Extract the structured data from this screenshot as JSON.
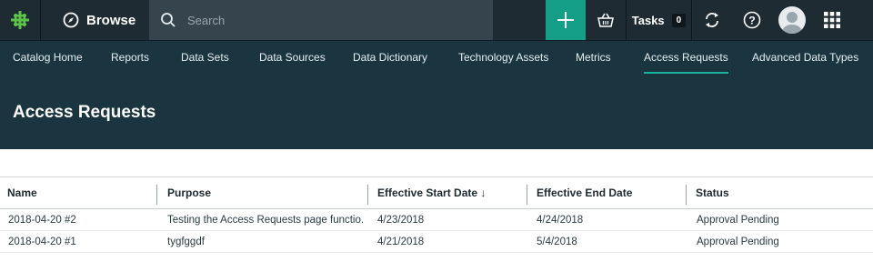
{
  "topbar": {
    "browse_label": "Browse",
    "search_placeholder": "Search",
    "tasks_label": "Tasks",
    "tasks_count": "0",
    "accent_color": "#149e88"
  },
  "nav": {
    "items": [
      {
        "label": "Catalog Home"
      },
      {
        "label": "Reports"
      },
      {
        "label": "Data Sets"
      },
      {
        "label": "Data Sources"
      },
      {
        "label": "Data Dictionary"
      },
      {
        "label": "Technology Assets"
      },
      {
        "label": "Metrics"
      },
      {
        "label": "Access Requests"
      },
      {
        "label": "Advanced Data Types"
      }
    ],
    "active": "Access Requests"
  },
  "page": {
    "title": "Access Requests"
  },
  "table": {
    "columns": [
      "Name",
      "Purpose",
      "Effective Start Date ↓",
      "Effective End Date",
      "Status"
    ],
    "rows": [
      [
        "2018-04-20 #2",
        "Testing the Access Requests page functio...",
        "4/23/2018",
        "4/24/2018",
        "Approval Pending"
      ],
      [
        "2018-04-20 #1",
        "tygfggdf",
        "4/21/2018",
        "5/4/2018",
        "Approval Pending"
      ]
    ]
  }
}
